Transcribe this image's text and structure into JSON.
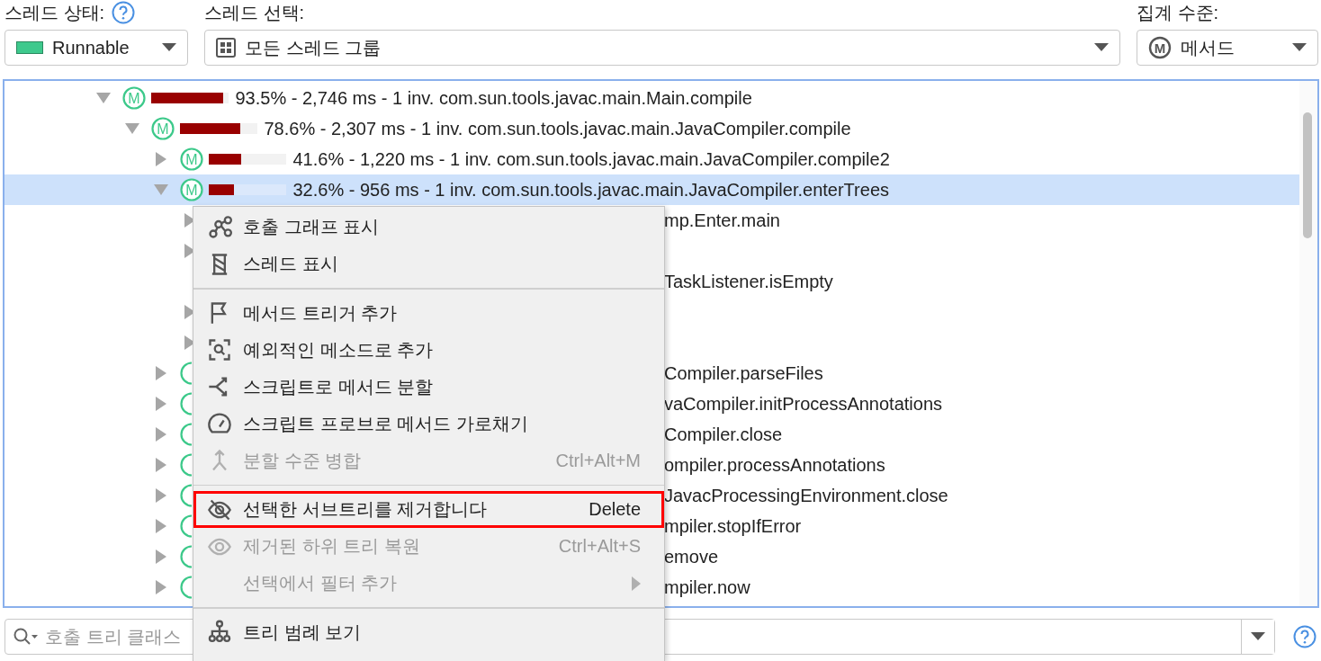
{
  "header": {
    "thread_state": {
      "label": "스레드 상태:",
      "value": "Runnable"
    },
    "thread_selection": {
      "label": "스레드 선택:",
      "value": "모든 스레드 그룹"
    },
    "aggregation": {
      "label": "집계 수준:",
      "badge": "M",
      "value": "메서드"
    }
  },
  "tree": {
    "rows": [
      {
        "kind": "method",
        "expanded": true,
        "selected": false,
        "badge": "M",
        "level": 0.935,
        "text": "93.5% - 2,746 ms - 1 inv. com.sun.tools.javac.main.Main.compile",
        "children": [
          {
            "kind": "method",
            "expanded": true,
            "selected": false,
            "badge": "M",
            "level": 0.786,
            "text": "78.6% - 2,307 ms - 1 inv. com.sun.tools.javac.main.JavaCompiler.compile",
            "children": [
              {
                "kind": "method",
                "expanded": false,
                "selected": false,
                "badge": "M",
                "level": 0.416,
                "text": "41.6% - 1,220 ms - 1 inv. com.sun.tools.javac.main.JavaCompiler.compile2"
              },
              {
                "kind": "method",
                "expanded": true,
                "selected": true,
                "badge": "M",
                "level": 0.326,
                "text": "32.6% - 956 ms - 1 inv. com.sun.tools.javac.main.JavaCompiler.enterTrees",
                "children": [
                  {
                    "kind": "covered",
                    "expanded": false,
                    "selected": false,
                    "text": "mp.Enter.main"
                  },
                  {
                    "kind": "covered",
                    "expanded": false,
                    "selected": false
                  },
                  {
                    "kind": "covered_leaf",
                    "selected": false,
                    "text": "TaskListener.isEmpty"
                  },
                  {
                    "kind": "covered",
                    "expanded": false,
                    "selected": false
                  },
                  {
                    "kind": "covered",
                    "expanded": false,
                    "selected": false
                  }
                ]
              },
              {
                "kind": "method_covered",
                "expanded": false,
                "selected": false,
                "text": "Compiler.parseFiles"
              },
              {
                "kind": "method_covered",
                "expanded": false,
                "selected": false,
                "text": "vaCompiler.initProcessAnnotations"
              },
              {
                "kind": "method_covered",
                "expanded": false,
                "selected": false,
                "text": "Compiler.close"
              },
              {
                "kind": "method_covered",
                "expanded": false,
                "selected": false,
                "text": "ompiler.processAnnotations"
              },
              {
                "kind": "method_covered",
                "expanded": false,
                "selected": false,
                "text": "JavacProcessingEnvironment.close"
              },
              {
                "kind": "method_covered",
                "expanded": false,
                "selected": false,
                "text": "mpiler.stopIfError"
              },
              {
                "kind": "method_covered",
                "expanded": false,
                "selected": false,
                "text": "emove"
              },
              {
                "kind": "method_covered",
                "expanded": false,
                "selected": false,
                "text": "mpiler.now"
              }
            ]
          }
        ]
      }
    ]
  },
  "context_menu": {
    "items": [
      {
        "kind": "item",
        "label": "호출 그래프 표시",
        "disabled": false,
        "highlighted": false,
        "submenu": false
      },
      {
        "kind": "item",
        "label": "스레드 표시",
        "disabled": false,
        "highlighted": false,
        "submenu": false
      },
      {
        "kind": "separator"
      },
      {
        "kind": "item",
        "label": "메서드 트리거 추가",
        "disabled": false,
        "highlighted": false,
        "submenu": false
      },
      {
        "kind": "item",
        "label": "예외적인 메소드로 추가",
        "disabled": false,
        "highlighted": false,
        "submenu": false
      },
      {
        "kind": "item",
        "label": "스크립트로 메서드 분할",
        "disabled": false,
        "highlighted": false,
        "submenu": false
      },
      {
        "kind": "item",
        "label": "스크립트 프로브로 메서드 가로채기",
        "disabled": false,
        "highlighted": false,
        "submenu": false
      },
      {
        "kind": "item",
        "label": "분할 수준 병합",
        "shortcut": "Ctrl+Alt+M",
        "disabled": true,
        "highlighted": false,
        "submenu": false
      },
      {
        "kind": "separator"
      },
      {
        "kind": "item",
        "label": "선택한 서브트리를 제거합니다",
        "shortcut": "Delete",
        "disabled": false,
        "highlighted": true,
        "submenu": false
      },
      {
        "kind": "item",
        "label": "제거된 하위 트리 복원",
        "shortcut": "Ctrl+Alt+S",
        "disabled": true,
        "highlighted": false,
        "submenu": false
      },
      {
        "kind": "item",
        "label": "선택에서 필터 추가",
        "disabled": true,
        "highlighted": false,
        "submenu": true
      },
      {
        "kind": "separator"
      },
      {
        "kind": "item",
        "label": "트리 범례 보기",
        "disabled": false,
        "highlighted": false,
        "submenu": false
      }
    ]
  },
  "search": {
    "placeholder": "호출 트리 클래스"
  }
}
